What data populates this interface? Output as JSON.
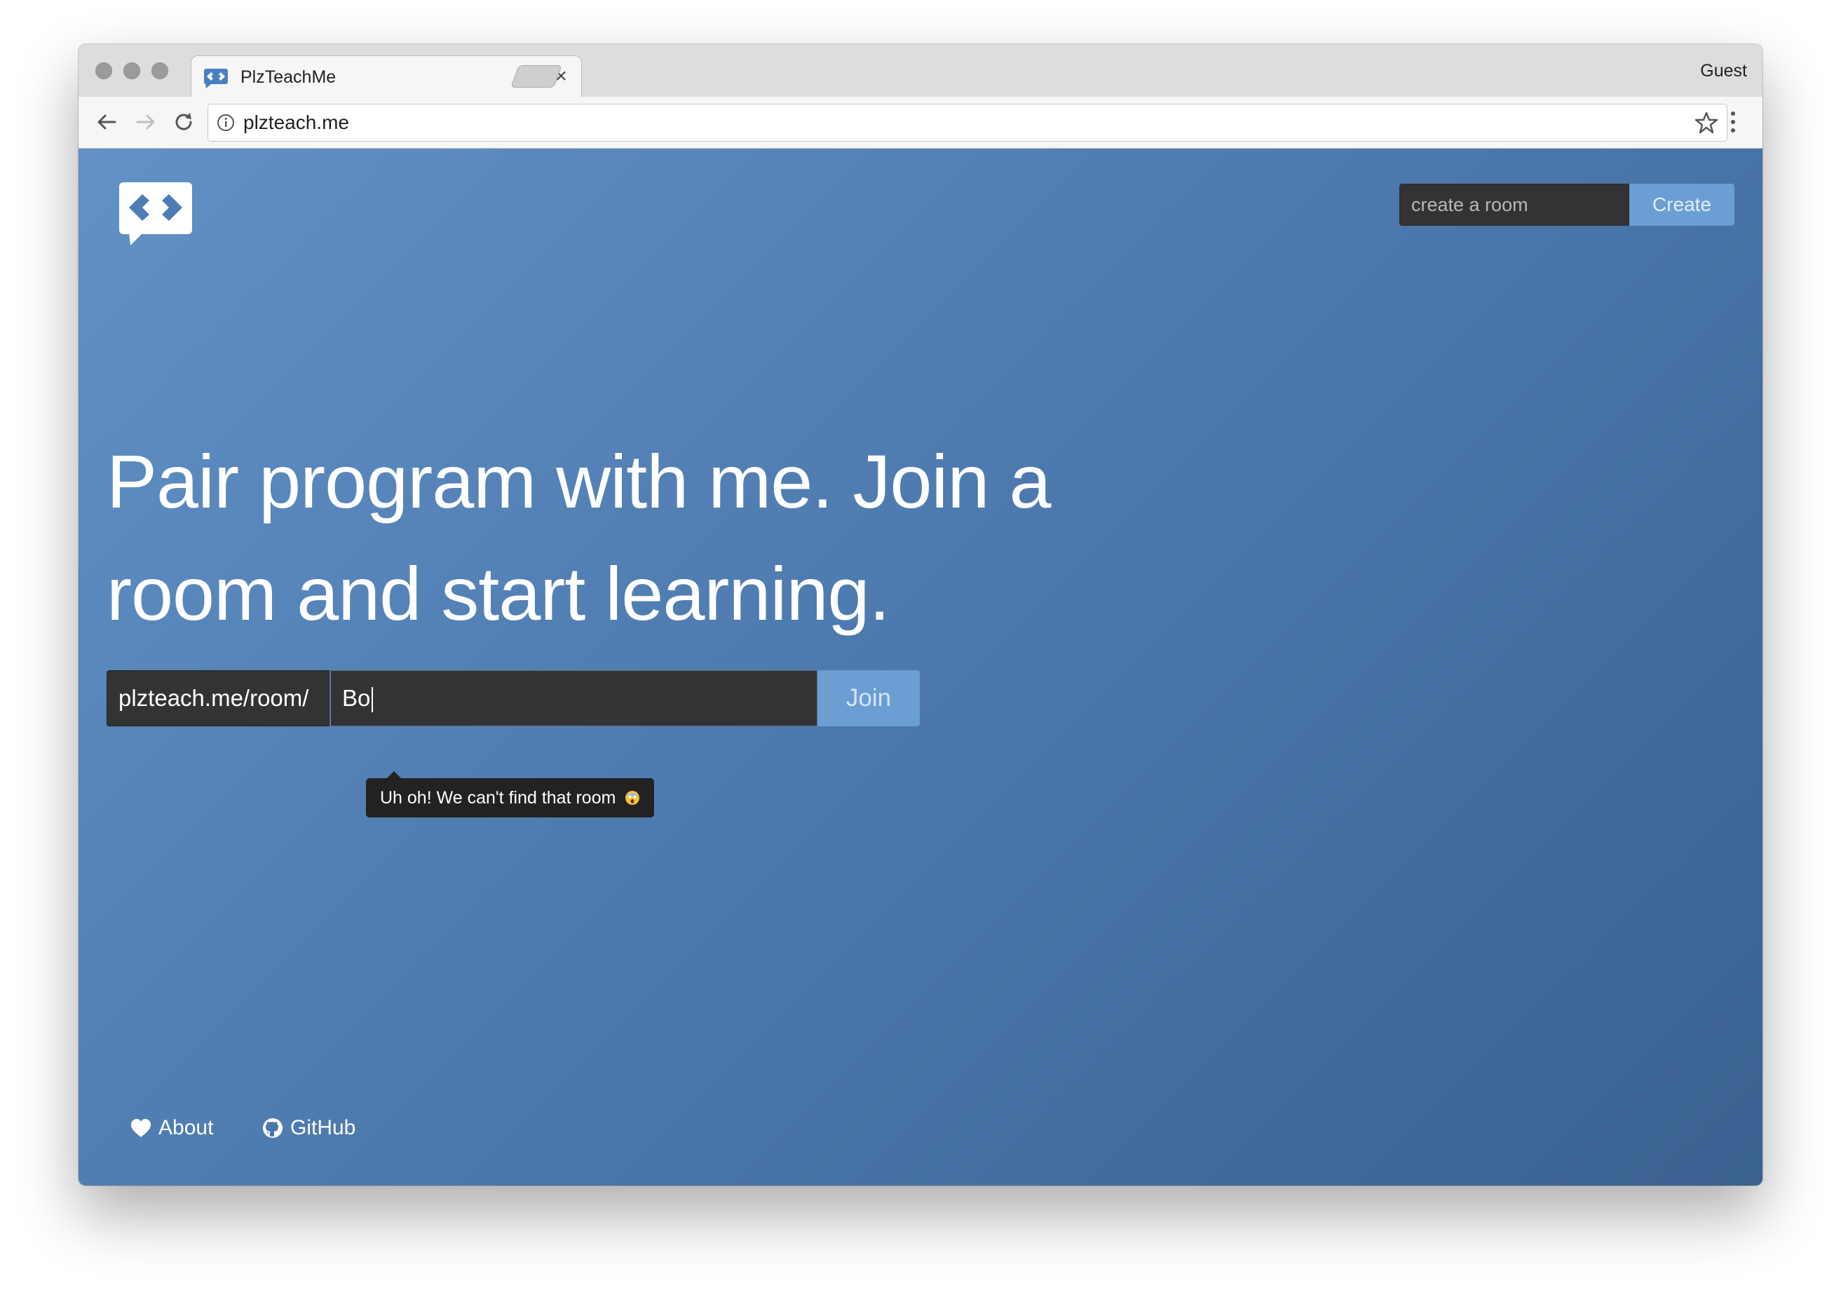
{
  "browser": {
    "tab_title": "PlzTeachMe",
    "profile_label": "Guest",
    "url": "plzteach.me"
  },
  "header": {
    "create_placeholder": "create a room",
    "create_button": "Create"
  },
  "hero": {
    "headline": "Pair program with me. Join a room and start learning."
  },
  "join": {
    "prefix": "plzteach.me/room/",
    "input_value": "Bo",
    "button": "Join",
    "error_tooltip": "Uh oh! We can't find that room"
  },
  "footer": {
    "about": "About",
    "github": "GitHub"
  },
  "colors": {
    "accent": "#6b9ed3",
    "background_top": "#6191c5",
    "background_bottom": "#3a6190",
    "input_dark": "#333333"
  }
}
